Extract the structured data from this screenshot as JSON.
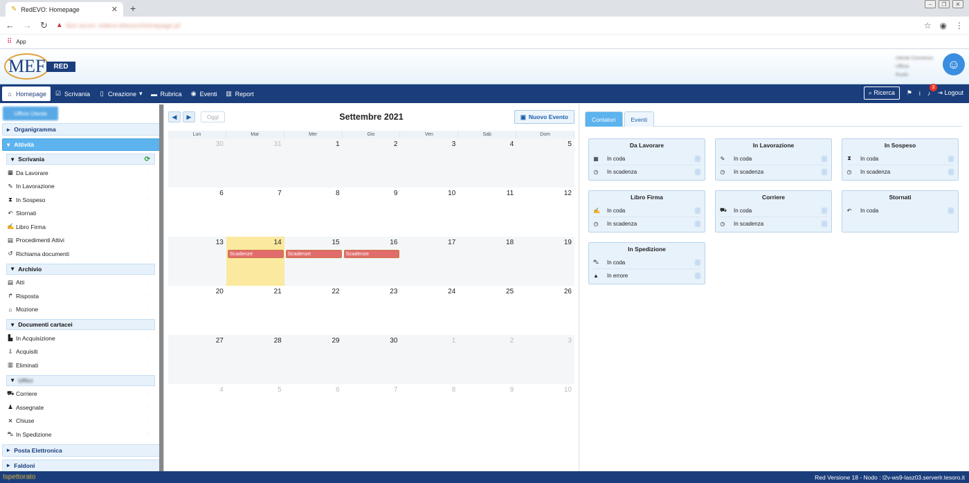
{
  "browser": {
    "tab_title": "RedEVO: Homepage",
    "url_warning": "Non sicuro",
    "url_blurred": "redevo.it/tesoro/homepage.jsf",
    "bookmark_apps": "App"
  },
  "header": {
    "brand_short": "MEF",
    "brand_tag": "RED",
    "user_lines": [
      "Utente Connesso",
      "Ufficio",
      "Ruolo"
    ]
  },
  "navbar": {
    "items": [
      {
        "label": "Homepage",
        "icon": "home-icon"
      },
      {
        "label": "Scrivania",
        "icon": "desk-icon"
      },
      {
        "label": "Creazione",
        "icon": "file-icon"
      },
      {
        "label": "Rubrica",
        "icon": "addressbook-icon"
      },
      {
        "label": "Eventi",
        "icon": "globe-icon"
      },
      {
        "label": "Report",
        "icon": "chart-icon"
      }
    ],
    "ricerca": "Ricerca",
    "notif_count": "3",
    "logout": "Logout"
  },
  "sidebar": {
    "user_button": "Ufficio Utente",
    "organigramma": "Organigramma",
    "attivita": "Attività",
    "scrivania": {
      "title": "Scrivania",
      "items": [
        {
          "label": "Da Lavorare",
          "icon": "▦"
        },
        {
          "label": "In Lavorazione",
          "icon": "✎"
        },
        {
          "label": "In Sospeso",
          "icon": "⧗"
        },
        {
          "label": "Stornati",
          "icon": "↶"
        },
        {
          "label": "Libro Firma",
          "icon": "✍"
        },
        {
          "label": "Procedimenti Attivi",
          "icon": "▤"
        },
        {
          "label": "Richiama documenti",
          "icon": "↺"
        }
      ]
    },
    "archivio": {
      "title": "Archivio",
      "items": [
        {
          "label": "Atti",
          "icon": "▤"
        },
        {
          "label": "Risposta",
          "icon": "↱"
        },
        {
          "label": "Mozione",
          "icon": "⌂"
        }
      ]
    },
    "documenti": {
      "title": "Documenti cartacei",
      "items": [
        {
          "label": "In Acquisizione",
          "icon": "▙"
        },
        {
          "label": "Acquisiti",
          "icon": "⇩"
        },
        {
          "label": "Eliminati",
          "icon": "▥"
        }
      ]
    },
    "uffici": {
      "title": "Uffici",
      "items": [
        {
          "label": "Corriere",
          "icon": "⛟"
        },
        {
          "label": "Assegnate",
          "icon": "♟"
        },
        {
          "label": "Chiuse",
          "icon": "✕"
        },
        {
          "label": "In Spedizione",
          "icon": "⛍"
        }
      ]
    },
    "posta": "Posta Elettronica",
    "faldoni": "Faldoni"
  },
  "calendar": {
    "title": "Settembre 2021",
    "oggi": "Oggi",
    "nuovo_evento": "Nuovo Evento",
    "days_of_week": [
      "Lun",
      "Mar",
      "Mer",
      "Gio",
      "Ven",
      "Sab",
      "Dom"
    ],
    "weeks": [
      [
        {
          "d": "30",
          "o": true
        },
        {
          "d": "31",
          "o": true
        },
        {
          "d": "1"
        },
        {
          "d": "2"
        },
        {
          "d": "3"
        },
        {
          "d": "4"
        },
        {
          "d": "5"
        }
      ],
      [
        {
          "d": "6"
        },
        {
          "d": "7"
        },
        {
          "d": "8"
        },
        {
          "d": "9"
        },
        {
          "d": "10"
        },
        {
          "d": "11"
        },
        {
          "d": "12"
        }
      ],
      [
        {
          "d": "13"
        },
        {
          "d": "14",
          "today": true,
          "ev": "Scadenze"
        },
        {
          "d": "15",
          "ev": "Scadenze"
        },
        {
          "d": "16",
          "ev": "Scadenze"
        },
        {
          "d": "17"
        },
        {
          "d": "18"
        },
        {
          "d": "19"
        }
      ],
      [
        {
          "d": "20"
        },
        {
          "d": "21"
        },
        {
          "d": "22"
        },
        {
          "d": "23"
        },
        {
          "d": "24"
        },
        {
          "d": "25"
        },
        {
          "d": "26"
        }
      ],
      [
        {
          "d": "27"
        },
        {
          "d": "28"
        },
        {
          "d": "29"
        },
        {
          "d": "30"
        },
        {
          "d": "1",
          "o": true
        },
        {
          "d": "2",
          "o": true
        },
        {
          "d": "3",
          "o": true
        }
      ],
      [
        {
          "d": "4",
          "o": true
        },
        {
          "d": "5",
          "o": true
        },
        {
          "d": "6",
          "o": true
        },
        {
          "d": "7",
          "o": true
        },
        {
          "d": "8",
          "o": true
        },
        {
          "d": "9",
          "o": true
        },
        {
          "d": "10",
          "o": true
        }
      ]
    ]
  },
  "counters": {
    "tabs": [
      "Contatori",
      "Eventi"
    ],
    "cards": [
      {
        "title": "Da Lavorare",
        "rows": [
          {
            "icon": "▦",
            "label": "In coda"
          },
          {
            "icon": "◷",
            "label": "In scadenza"
          }
        ]
      },
      {
        "title": "In Lavorazione",
        "rows": [
          {
            "icon": "✎",
            "label": "In coda"
          },
          {
            "icon": "◷",
            "label": "In scadenza"
          }
        ]
      },
      {
        "title": "In Sospeso",
        "rows": [
          {
            "icon": "⧗",
            "label": "In coda"
          },
          {
            "icon": "◷",
            "label": "In scadenza"
          }
        ]
      },
      {
        "title": "Libro Firma",
        "rows": [
          {
            "icon": "✍",
            "label": "In coda"
          },
          {
            "icon": "◷",
            "label": "In scadenza"
          }
        ]
      },
      {
        "title": "Corriere",
        "rows": [
          {
            "icon": "⛟",
            "label": "In coda"
          },
          {
            "icon": "◷",
            "label": "In scadenza"
          }
        ]
      },
      {
        "title": "Stornati",
        "rows": [
          {
            "icon": "↶",
            "label": "In coda"
          }
        ]
      },
      {
        "title": "In Spedizione",
        "rows": [
          {
            "icon": "⛍",
            "label": "In coda"
          },
          {
            "icon": "▲",
            "label": "In errore"
          }
        ]
      }
    ]
  },
  "status": {
    "version": "Red Versione 18 - Nodo : l2v-ws9-lasz03.serverlr.tesoro.it",
    "left": "Ispettorato"
  }
}
